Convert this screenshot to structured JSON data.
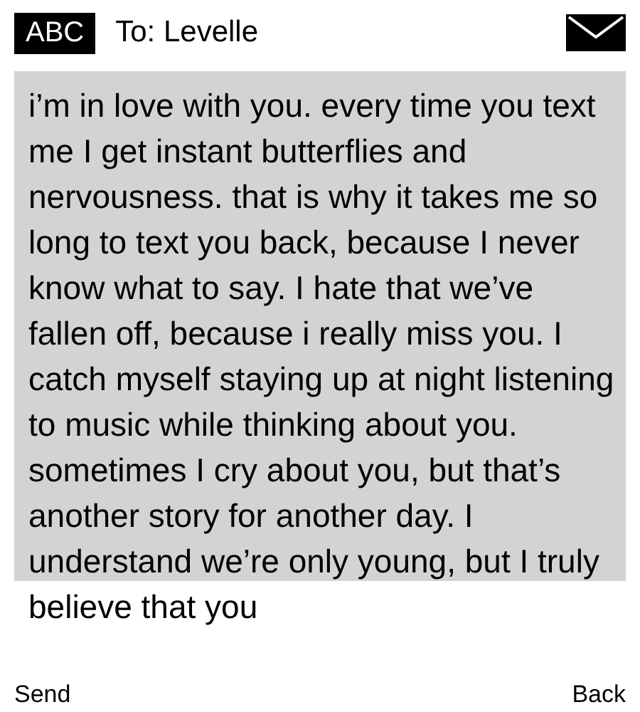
{
  "header": {
    "badge": "ABC",
    "recipient": "To: Levelle"
  },
  "message": "i’m in love with you. every time you text me I get instant butterflies and nervousness. that is why it takes me so long to text you back, because I never know what to say. I hate that we’ve fallen off, because i really miss you. I catch myself staying up at night listening to music while thinking about you. sometimes I cry about you, but that’s another story for another day. I understand we’re only young, but I truly believe that you",
  "softkeys": [
    {
      "label": "Send"
    },
    {
      "label": "Back"
    }
  ]
}
